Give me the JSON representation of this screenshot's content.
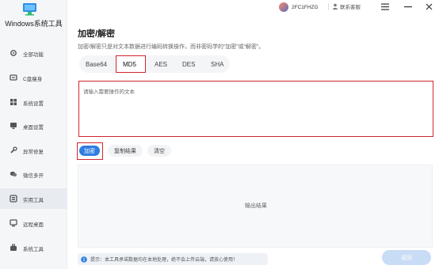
{
  "app": {
    "title": "Windows系统工具"
  },
  "topbar": {
    "user_id": "2FC1FHZG",
    "vip_label": "联系客服",
    "menu_icon": "menu-icon",
    "minimize_icon": "minimize-icon",
    "close_icon": "close-icon"
  },
  "sidebar": {
    "items": [
      {
        "label": "全部功能",
        "icon": "gear-icon"
      },
      {
        "label": "C盘瘦身",
        "icon": "disk-icon"
      },
      {
        "label": "系统设置",
        "icon": "grid-icon"
      },
      {
        "label": "桌面设置",
        "icon": "monitor-icon"
      },
      {
        "label": "异常修复",
        "icon": "wrench-icon"
      },
      {
        "label": "微信多开",
        "icon": "chat-icon"
      },
      {
        "label": "实用工具",
        "icon": "tools-icon",
        "active": true
      },
      {
        "label": "远程桌面",
        "icon": "remote-icon"
      },
      {
        "label": "系统工具",
        "icon": "toolbox-icon"
      }
    ]
  },
  "main": {
    "title": "加密/解密",
    "description": "加密/解密只是对文本数据进行编码转换操作，而非密码学的“加密”或“解密”。",
    "tabs": [
      {
        "label": "Base64"
      },
      {
        "label": "MD5",
        "selected": true
      },
      {
        "label": "AES"
      },
      {
        "label": "DES"
      },
      {
        "label": "SHA"
      }
    ],
    "input": {
      "placeholder": "请输入需要操作的文本",
      "value": ""
    },
    "buttons": {
      "encrypt": "加密",
      "copy": "复制结果",
      "clear": "清空"
    },
    "output_placeholder": "输出结果",
    "notice": "提示：本工具承诺数据均在本地处理，绝不会上传云端，请放心使用！",
    "back": "返回"
  },
  "colors": {
    "accent": "#2f7de1",
    "highlight_border": "#d0262e",
    "back_button": "#c9dcf5"
  }
}
